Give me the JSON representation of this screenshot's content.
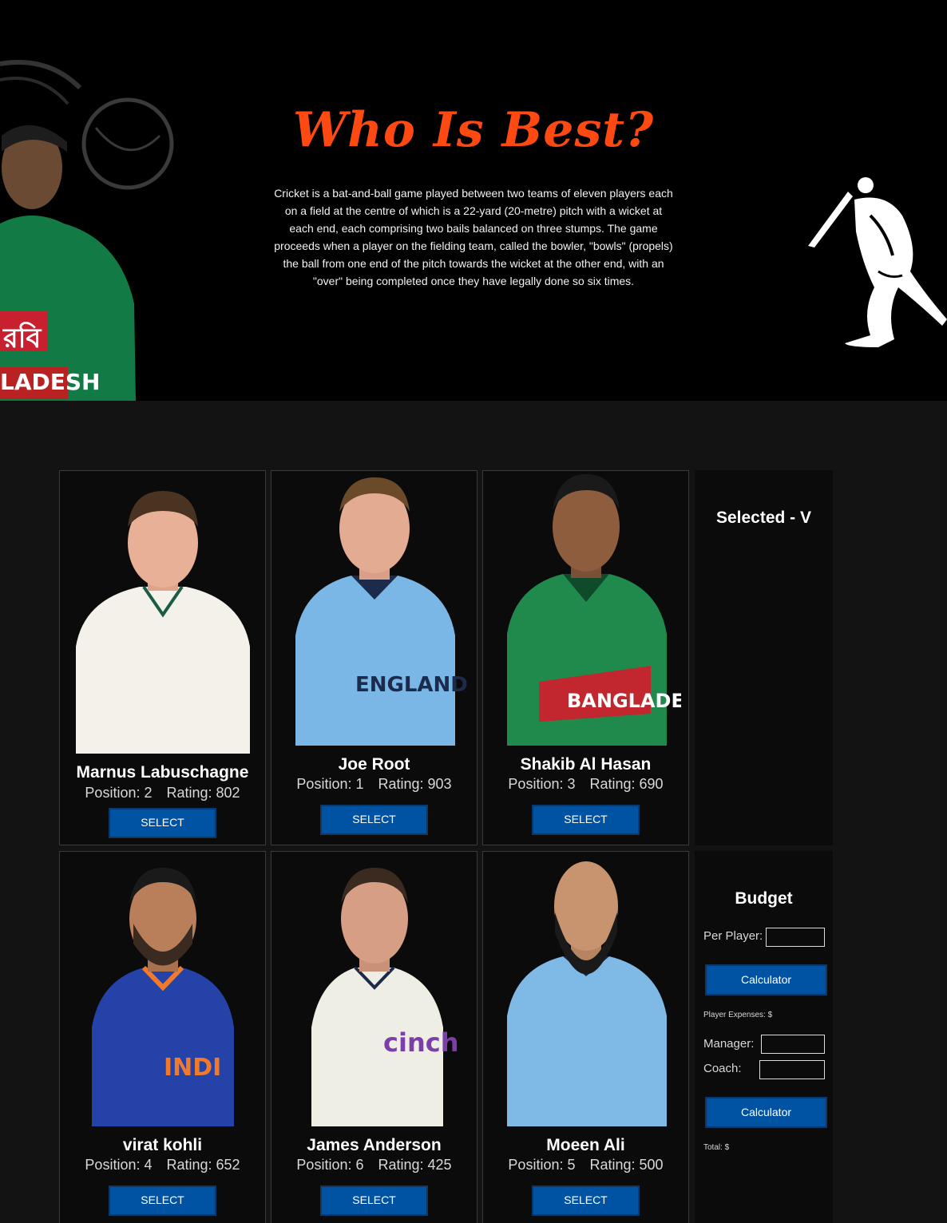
{
  "hero": {
    "title": "Who Is Best?",
    "description": "Cricket is a bat-and-ball game played between two teams of eleven players each on a field at the centre of which is a 22-yard (20-metre) pitch with a wicket at each end, each comprising two bails balanced on three stumps. The game proceeds when a player on the fielding team, called the bowler, \"bowls\" (propels) the ball from one end of the pitch towards the wicket at the other end, with an \"over\" being completed once they have legally done so six times."
  },
  "players": [
    {
      "name": "Marnus Labuschagne",
      "position": "Position: 2",
      "rating": "Rating: 802",
      "button": "SELECT",
      "jersey": "#f4f1ea"
    },
    {
      "name": "Joe Root",
      "position": "Position: 1",
      "rating": "Rating: 903",
      "button": "SELECT",
      "jersey": "#7ab6e6"
    },
    {
      "name": "Shakib Al Hasan",
      "position": "Position: 3",
      "rating": "Rating: 690",
      "button": "SELECT",
      "jersey": "#1f8a4c"
    },
    {
      "name": "virat kohli",
      "position": "Position: 4",
      "rating": "Rating: 652",
      "button": "SELECT",
      "jersey": "#2442a8"
    },
    {
      "name": "James Anderson",
      "position": "Position: 6",
      "rating": "Rating: 425",
      "button": "SELECT",
      "jersey": "#efeee4"
    },
    {
      "name": "Moeen Ali",
      "position": "Position: 5",
      "rating": "Rating: 500",
      "button": "SELECT",
      "jersey": "#7fb9e6"
    }
  ],
  "selected": {
    "title": "Selected - V"
  },
  "budget": {
    "title": "Budget",
    "per_player_label": "Per Player:",
    "calculator_label": "Calculator",
    "player_expenses": "Player Expenses: $",
    "manager_label": "Manager:",
    "coach_label": "Coach:",
    "calculator_total_label": "Calculator",
    "total": "Total: $"
  },
  "colors": {
    "accent": "#fe4a12",
    "button": "#0052a2"
  }
}
